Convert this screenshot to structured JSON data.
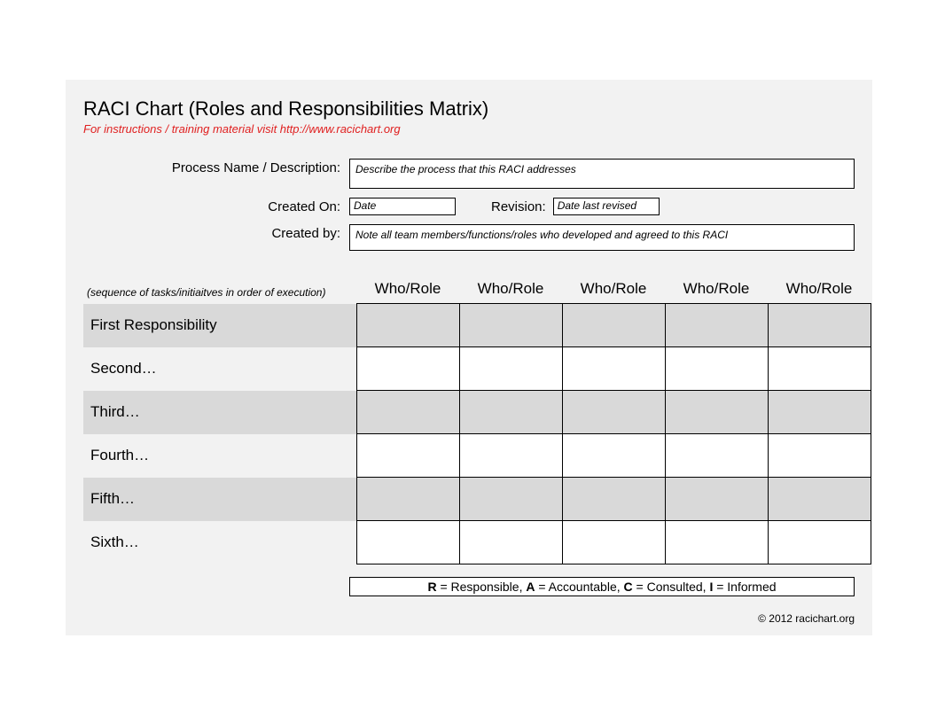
{
  "header": {
    "title": "RACI Chart (Roles and Responsibilities Matrix)",
    "subtitle": "For instructions / training material visit http://www.racichart.org"
  },
  "meta": {
    "process_label": "Process Name / Description:",
    "process_placeholder": "Describe the process that this RACI addresses",
    "created_on_label": "Created On:",
    "created_on_placeholder": "Date",
    "revision_label": "Revision:",
    "revision_placeholder": "Date last revised",
    "created_by_label": "Created by:",
    "created_by_placeholder": "Note all team members/functions/roles who developed and agreed to this RACI"
  },
  "matrix": {
    "task_head": "(sequence of tasks/initiaitves in order of execution)",
    "role_head": "Who/Role",
    "tasks": [
      "First Responsibility",
      "Second…",
      "Third…",
      "Fourth…",
      "Fifth…",
      "Sixth…"
    ]
  },
  "legend": {
    "r_key": "R",
    "r_val": " = Responsible,   ",
    "a_key": "A",
    "a_val": " = Accountable,  ",
    "c_key": "C",
    "c_val": " = Consulted,  ",
    "i_key": "I",
    "i_val": " = Informed"
  },
  "footer": {
    "copyright": "© 2012 racichart.org"
  }
}
